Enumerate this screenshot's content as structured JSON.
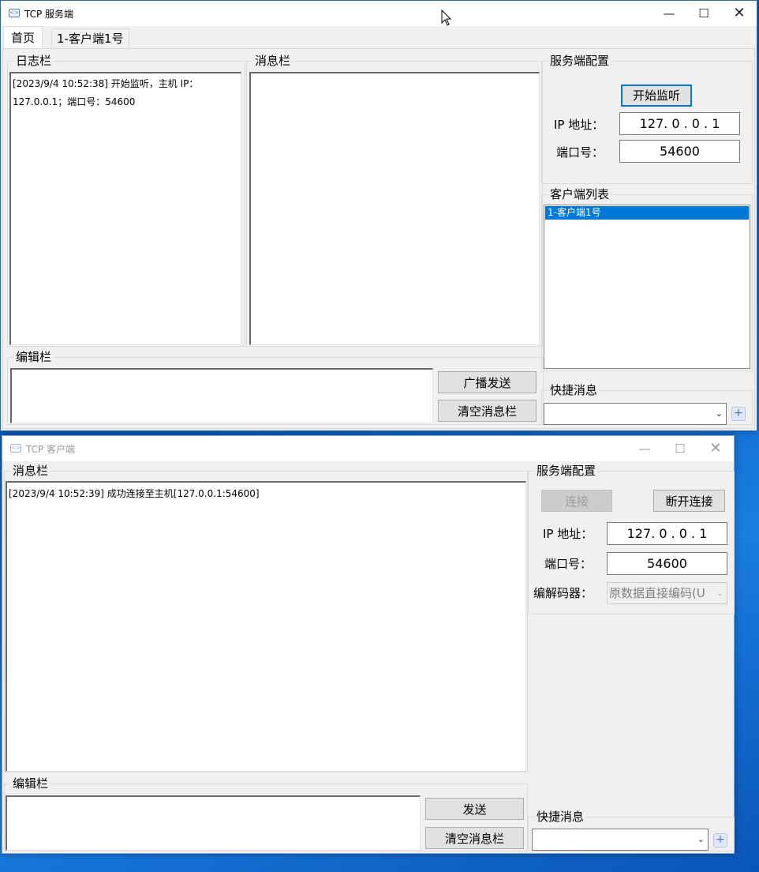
{
  "server": {
    "title": "TCP 服务端",
    "tabs": [
      {
        "label": "首页"
      },
      {
        "label": "1-客户端1号"
      }
    ],
    "log": {
      "legend": "日志栏",
      "lines": [
        "[2023/9/4 10:52:38] 开始监听，主机 IP：",
        "127.0.0.1；端口号：54600"
      ]
    },
    "messages": {
      "legend": "消息栏"
    },
    "config": {
      "legend": "服务端配置",
      "start_button": "开始监听",
      "ip_label": "IP 地址：",
      "ip_value": "127. 0 . 0 . 1",
      "port_label": "端口号：",
      "port_value": "54600"
    },
    "clients": {
      "legend": "客户端列表",
      "items": [
        "1-客户端1号"
      ]
    },
    "editor": {
      "legend": "编辑栏",
      "broadcast_button": "广播发送",
      "clear_button": "清空消息栏"
    },
    "quick": {
      "legend": "快捷消息",
      "value": ""
    }
  },
  "client": {
    "title": "TCP 客户端",
    "messages": {
      "legend": "消息栏",
      "lines": [
        "[2023/9/4 10:52:39] 成功连接至主机[127.0.0.1:54600]"
      ]
    },
    "config": {
      "legend": "服务端配置",
      "connect_button": "连接",
      "disconnect_button": "断开连接",
      "ip_label": "IP 地址：",
      "ip_value": "127. 0 . 0 . 1",
      "port_label": "端口号：",
      "port_value": "54600",
      "codec_label": "编解码器：",
      "codec_value": "原数据直接编码(U"
    },
    "editor": {
      "legend": "编辑栏",
      "send_button": "发送",
      "clear_button": "清空消息栏"
    },
    "quick": {
      "legend": "快捷消息",
      "value": ""
    }
  },
  "icons": {
    "minimize": "minimize-icon",
    "maximize": "maximize-icon",
    "close": "close-icon",
    "cursor": "mouse-cursor-icon"
  }
}
